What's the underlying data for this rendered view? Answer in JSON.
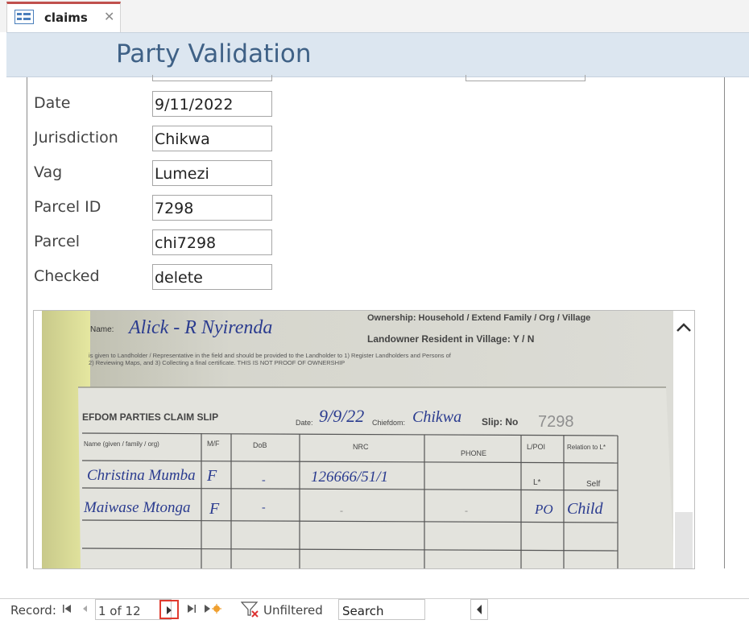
{
  "tab": {
    "label": "claims",
    "close": "✕"
  },
  "form": {
    "title": "Party Validation"
  },
  "fields": [
    {
      "label": "Date",
      "value": "9/11/2022"
    },
    {
      "label": "Jurisdiction",
      "value": "Chikwa"
    },
    {
      "label": "Vag",
      "value": "Lumezi"
    },
    {
      "label": "Parcel ID",
      "value": "7298"
    },
    {
      "label": "Parcel",
      "value": "chi7298"
    },
    {
      "label": "Checked",
      "value": "delete"
    }
  ],
  "attachment": {
    "hw_name": "Alick - R Nyirenda",
    "name_prefix": "Name:",
    "ownership": "Ownership: Household / Extend Family / Org / Village",
    "resident": "Landowner Resident in Village: Y / N",
    "notice_1": "is given to Landholder / Representative in the field and should be provided to the Landholder to 1) Register Landholders and Persons of",
    "notice_2": "2) Reviewing Maps, and 3) Collecting a final certificate. THIS IS NOT PROOF OF OWNERSHIP",
    "slip_title": "EFDOM PARTIES CLAIM SLIP",
    "date_label": "Date:",
    "date_value": "9/9/22",
    "chiefdom_label": "Chiefdom:",
    "chiefdom_value": "Chikwa",
    "slip_label": "Slip: No",
    "slip_value": "7298",
    "columns": [
      "Name (given / family / org)",
      "M/F",
      "DoB",
      "NRC",
      "PHONE",
      "L/POI",
      "Relation to L*"
    ],
    "rows": [
      {
        "name": "Christina Mumba",
        "mf": "F",
        "dob": "-",
        "nrc": "126666/51/1",
        "phone": "",
        "lpoi": "L*",
        "relation": "Self"
      },
      {
        "name": "Maiwase Mtonga",
        "mf": "F",
        "dob": "-",
        "nrc": "-",
        "phone": "-",
        "lpoi": "PO",
        "relation": "Child"
      }
    ]
  },
  "record_nav": {
    "label": "Record:",
    "current": "1 of 12",
    "filter": "Unfiltered",
    "search": "Search"
  },
  "colors": {
    "accent_tab": "#c0504d",
    "header_bg": "#dce6f0",
    "title_color": "#3f6186",
    "highlight": "#e03a2e"
  }
}
